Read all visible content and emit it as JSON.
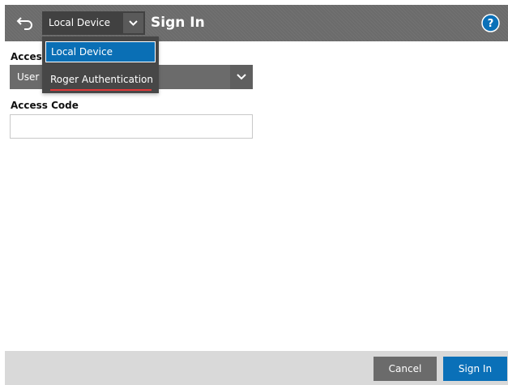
{
  "header": {
    "title": "Sign In",
    "device_select_value": "Local Device",
    "back_icon": "back-arrow-icon",
    "help_icon": "help-icon"
  },
  "form": {
    "access_label": "Acces",
    "access_method_value": "User",
    "access_code_label": "Access Code",
    "access_code_value": ""
  },
  "dropdown": {
    "options": [
      {
        "label": "Local Device",
        "selected": true
      },
      {
        "label": "Roger Authentication",
        "selected": false
      }
    ]
  },
  "footer": {
    "cancel_label": "Cancel",
    "signin_label": "Sign In"
  },
  "colors": {
    "header_bg": "#6b6b6b",
    "accent_blue": "#0a70b8",
    "annotation_red": "#e23a3a"
  }
}
